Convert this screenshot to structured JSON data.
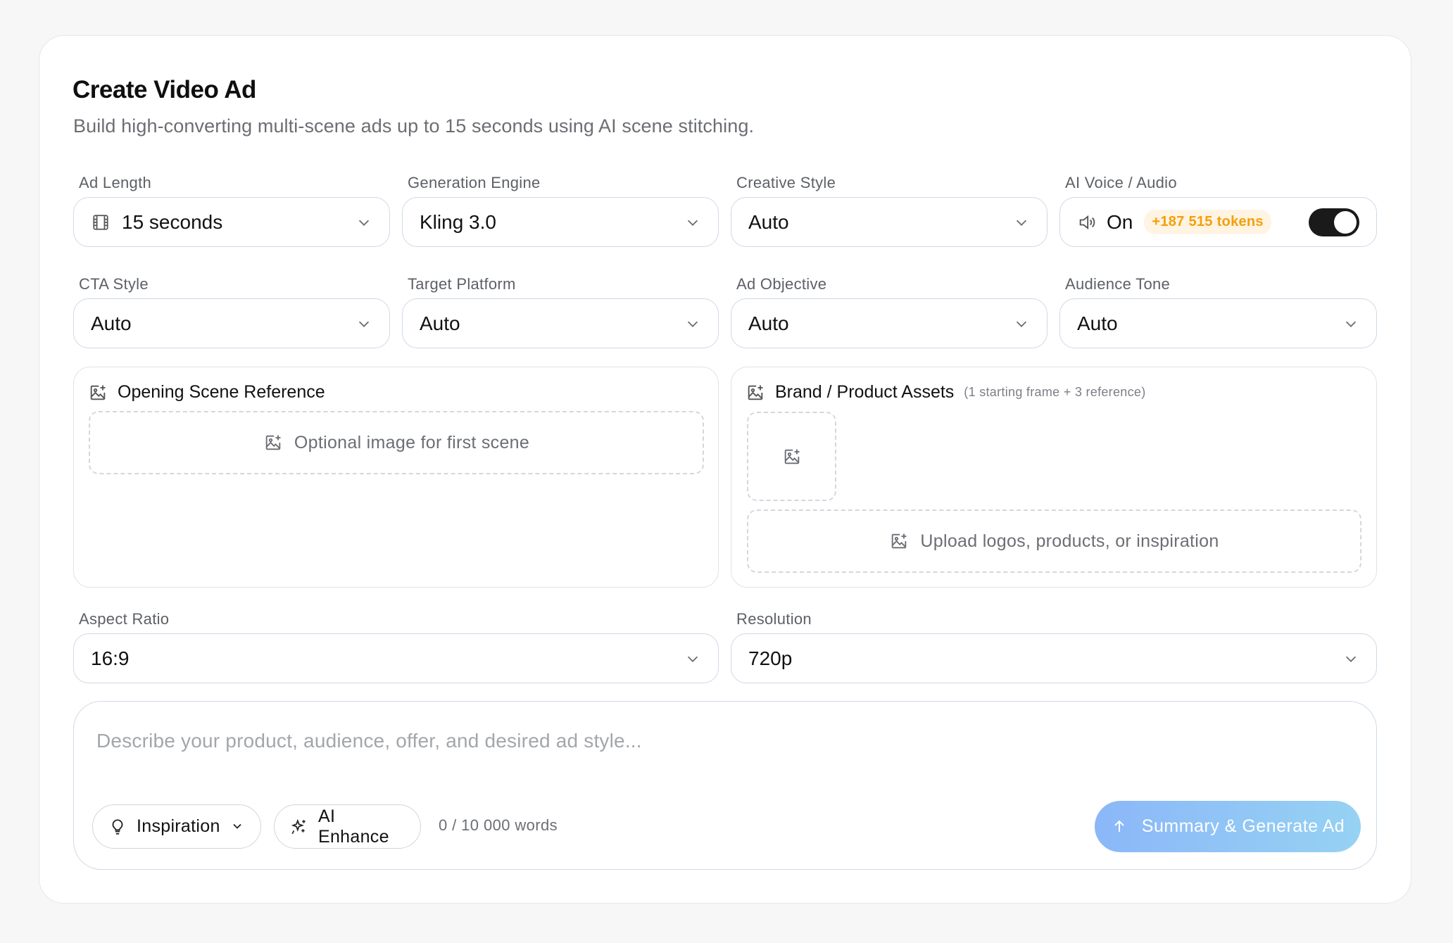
{
  "header": {
    "title": "Create Video Ad",
    "subtitle": "Build high-converting multi-scene ads up to 15 seconds using AI scene stitching."
  },
  "fields": {
    "ad_length": {
      "label": "Ad Length",
      "value": "15 seconds",
      "icon": "film-icon"
    },
    "engine": {
      "label": "Generation Engine",
      "value": "Kling 3.0"
    },
    "creative_style": {
      "label": "Creative Style",
      "value": "Auto"
    },
    "voice": {
      "label": "AI Voice / Audio",
      "value": "On",
      "tokens": "+187 515 tokens",
      "enabled": true,
      "icon": "speaker-icon"
    },
    "cta_style": {
      "label": "CTA Style",
      "value": "Auto"
    },
    "target_platform": {
      "label": "Target Platform",
      "value": "Auto"
    },
    "ad_objective": {
      "label": "Ad Objective",
      "value": "Auto"
    },
    "audience_tone": {
      "label": "Audience Tone",
      "value": "Auto"
    },
    "aspect_ratio": {
      "label": "Aspect Ratio",
      "value": "16:9"
    },
    "resolution": {
      "label": "Resolution",
      "value": "720p"
    }
  },
  "opening_scene": {
    "title": "Opening Scene Reference",
    "dropzone": "Optional image for first scene"
  },
  "brand_assets": {
    "title": "Brand / Product Assets",
    "note": "(1 starting frame + 3 reference)",
    "dropzone": "Upload logos, products, or inspiration"
  },
  "prompt": {
    "placeholder": "Describe your product, audience, offer, and desired ad style...",
    "inspiration_label": "Inspiration",
    "enhance_label": "AI Enhance",
    "word_count": "0 / 10 000 words",
    "generate_label": "Summary & Generate Ad"
  },
  "colors": {
    "accent_gradient_start": "#8bb7f8",
    "accent_gradient_end": "#96d2f3",
    "token_badge_text": "#f59e0b",
    "token_badge_bg": "#fff4e2",
    "toggle_on": "#1a1a1a"
  }
}
